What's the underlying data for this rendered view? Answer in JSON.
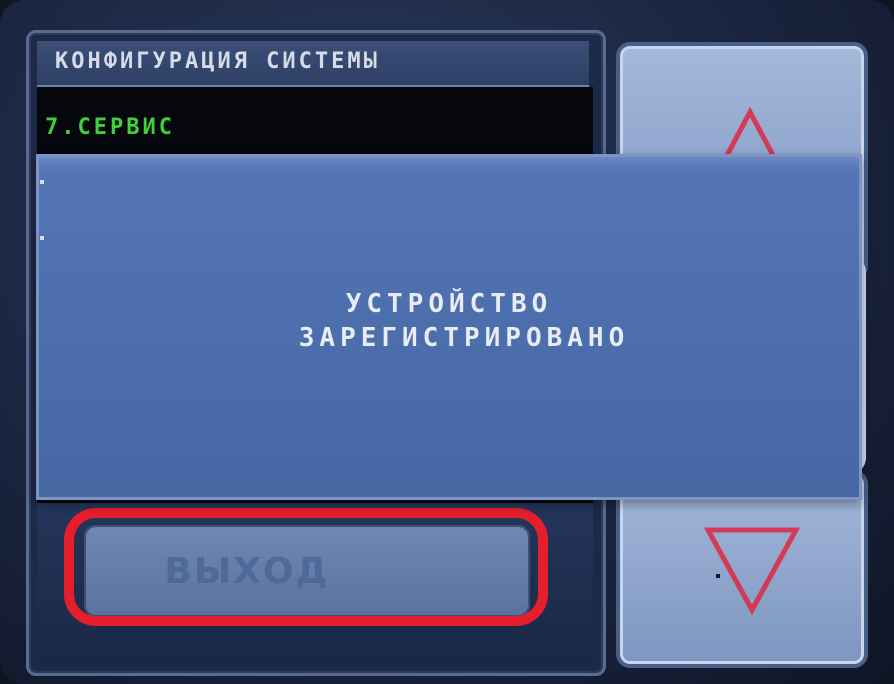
{
  "panel": {
    "title": "КОНФИГУРАЦИЯ СИСТЕМЫ",
    "list_items": [
      "7.СЕРВИС"
    ]
  },
  "dialog": {
    "line1": "УСТРОЙСТВО",
    "line2": "ЗАРЕГИСТРИРОВАНО"
  },
  "buttons": {
    "exit_label": "ВЫХОД"
  },
  "icons": {
    "scroll_up": "triangle-up-icon",
    "scroll_down": "triangle-down-icon"
  },
  "colors": {
    "list_text": "#3ed13a",
    "highlight": "#e41e2a",
    "dialog_bg": "#4d6fae"
  }
}
